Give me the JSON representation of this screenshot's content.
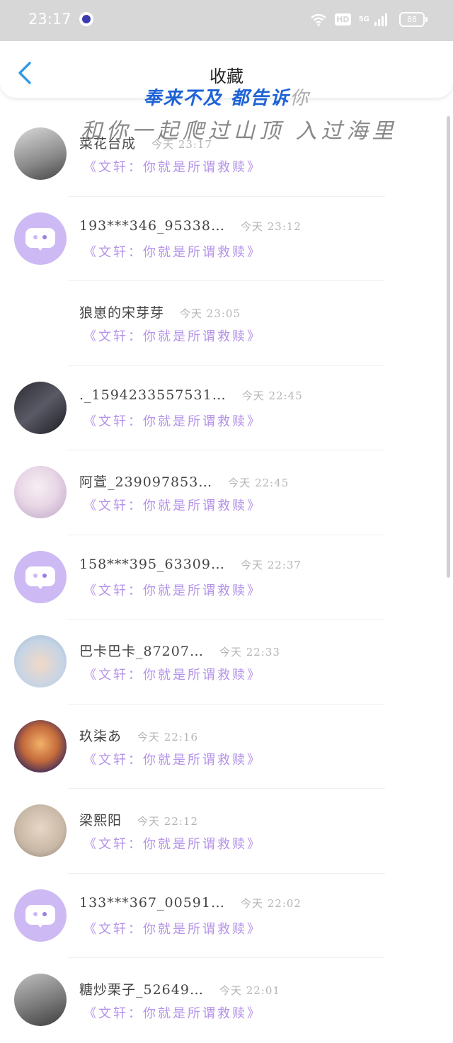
{
  "status_bar": {
    "time": "23:17",
    "hd": "HD",
    "network": "5G",
    "battery": "88"
  },
  "header": {
    "title": "收藏"
  },
  "overlay": {
    "line1_blue": "来不及 都告诉",
    "line1_prefix": "奉",
    "line1_suffix": "你",
    "line2": "和你一起爬过山顶 入过海里"
  },
  "items": [
    {
      "name": "菜花台成",
      "time": "今天 23:17",
      "book": "《文轩：你就是所谓救赎》",
      "avatar": "photo1"
    },
    {
      "name": "193***346_95338…",
      "time": "今天 23:12",
      "book": "《文轩：你就是所谓救赎》",
      "avatar": "default"
    },
    {
      "name": "狼崽的宋芽芽",
      "time": "今天 23:05",
      "book": "《文轩：你就是所谓救赎》",
      "avatar": "none"
    },
    {
      "name": "._1594233557531…",
      "time": "今天 22:45",
      "book": "《文轩：你就是所谓救赎》",
      "avatar": "photo2"
    },
    {
      "name": "阿萱_239097853…",
      "time": "今天 22:45",
      "book": "《文轩：你就是所谓救赎》",
      "avatar": "photo3"
    },
    {
      "name": "158***395_63309…",
      "time": "今天 22:37",
      "book": "《文轩：你就是所谓救赎》",
      "avatar": "default"
    },
    {
      "name": "巴卡巴卡_87207…",
      "time": "今天 22:33",
      "book": "《文轩：你就是所谓救赎》",
      "avatar": "photo4"
    },
    {
      "name": "玖柒あ",
      "time": "今天 22:16",
      "book": "《文轩：你就是所谓救赎》",
      "avatar": "photo5"
    },
    {
      "name": "梁熙阳",
      "time": "今天 22:12",
      "book": "《文轩：你就是所谓救赎》",
      "avatar": "photo6"
    },
    {
      "name": "133***367_00591…",
      "time": "今天 22:02",
      "book": "《文轩：你就是所谓救赎》",
      "avatar": "default"
    },
    {
      "name": "糖炒栗子_52649…",
      "time": "今天 22:01",
      "book": "《文轩：你就是所谓救赎》",
      "avatar": "photo7"
    }
  ],
  "colors": {
    "accent": "#2f9be8",
    "book_text": "#b493e8",
    "default_avatar": "#cdb9f3",
    "status_bar_bg": "#d7d7d7"
  }
}
